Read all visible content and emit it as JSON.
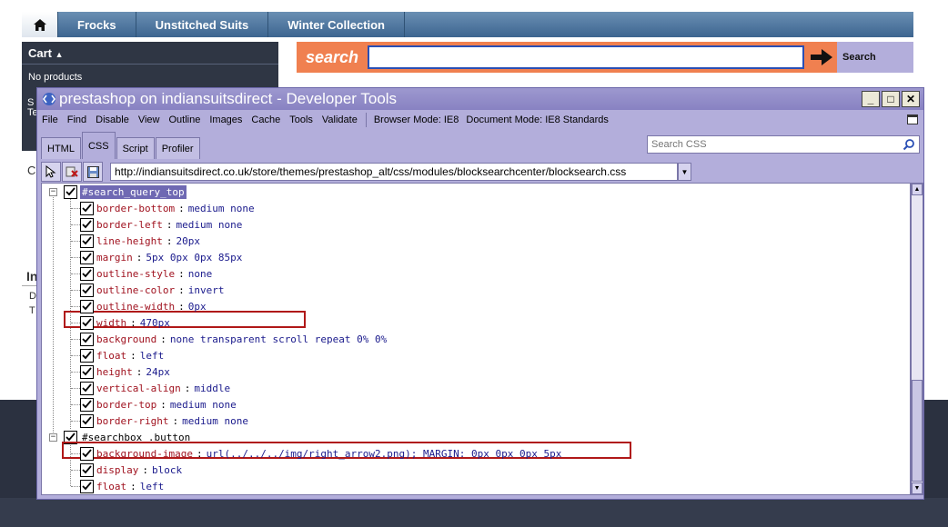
{
  "site": {
    "nav_items": [
      "Frocks",
      "Unstitched Suits",
      "Winter Collection"
    ],
    "cart_title": "Cart",
    "cart_empty": "No products",
    "cart_frag_1": "S",
    "cart_frag_2": "Te",
    "frag_c": "C",
    "frag_in": "In",
    "frag_d": "D",
    "frag_t": "T",
    "search_label": "search",
    "search_value": "",
    "search_button": "Search"
  },
  "devtools": {
    "title": "prestashop on indiansuitsdirect - Developer Tools",
    "window_buttons": [
      "_",
      "□",
      "✕"
    ],
    "menu": [
      "File",
      "Find",
      "Disable",
      "View",
      "Outline",
      "Images",
      "Cache",
      "Tools",
      "Validate"
    ],
    "browser_mode": "Browser Mode: IE8",
    "document_mode": "Document Mode: IE8 Standards",
    "tabs": [
      "HTML",
      "CSS",
      "Script",
      "Profiler"
    ],
    "active_tab": "CSS",
    "search_placeholder": "Search CSS",
    "url": "http://indiansuitsdirect.co.uk/store/themes/prestashop_alt/css/modules/blocksearchcenter/blocksearch.css",
    "rules": [
      {
        "selector": "#search_query_top",
        "selected": true,
        "properties": [
          {
            "name": "border-bottom",
            "value": "medium none"
          },
          {
            "name": "border-left",
            "value": "medium none"
          },
          {
            "name": "line-height",
            "value": "20px"
          },
          {
            "name": "margin",
            "value": "5px 0px 0px 85px"
          },
          {
            "name": "outline-style",
            "value": "none"
          },
          {
            "name": "outline-color",
            "value": "invert"
          },
          {
            "name": "outline-width",
            "value": "0px"
          },
          {
            "name": "width",
            "value": "470px",
            "highlighted": true
          },
          {
            "name": "background",
            "value": "none transparent scroll repeat 0% 0%"
          },
          {
            "name": "float",
            "value": "left"
          },
          {
            "name": "height",
            "value": "24px"
          },
          {
            "name": "vertical-align",
            "value": "middle"
          },
          {
            "name": "border-top",
            "value": "medium none"
          },
          {
            "name": "border-right",
            "value": "medium none"
          }
        ]
      },
      {
        "selector": "#searchbox .button",
        "selected": false,
        "properties": [
          {
            "name": "background-image",
            "value": "url(../../../img/right_arrow2.png); MARGIN: 0px 0px 0px 5px",
            "highlighted": true
          },
          {
            "name": "display",
            "value": "block"
          },
          {
            "name": "float",
            "value": "left"
          }
        ]
      }
    ]
  },
  "colors": {
    "selected_selector_bg": "#6f69b3",
    "prop_name": "#a0121f",
    "prop_value": "#1a1a8c",
    "highlight_box": "#b01818",
    "devtools_chrome": "#b3aedb",
    "search_orange": "#f08050"
  }
}
